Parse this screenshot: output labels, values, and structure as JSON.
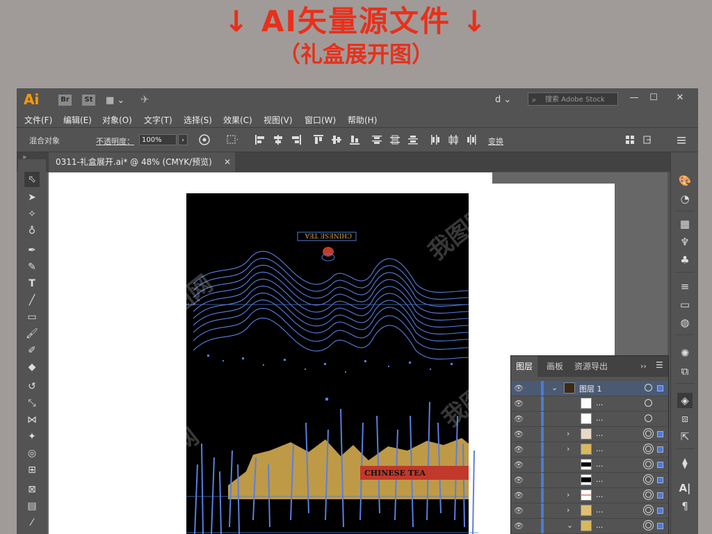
{
  "banner": {
    "title": "↓ AI矢量源文件 ↓",
    "subtitle": "（礼盒展开图）"
  },
  "appbar": {
    "logo": "Ai",
    "apps": [
      "Br",
      "St"
    ],
    "workspace_icon": "workspace-switcher-icon",
    "user": "d",
    "stock_search_placeholder": "搜索 Adobe Stock",
    "window_buttons": [
      "—",
      "☐",
      "✕"
    ]
  },
  "menubar": {
    "items": [
      "文件(F)",
      "编辑(E)",
      "对象(O)",
      "文字(T)",
      "选择(S)",
      "效果(C)",
      "视图(V)",
      "窗口(W)",
      "帮助(H)"
    ]
  },
  "control_bar": {
    "selection_type": "混合对象",
    "opacity_label": "不透明度：",
    "opacity_value": "100%",
    "transform_label": "变换"
  },
  "document_tab": {
    "title": "0311-礼盒展开.ai* @ 48% (CMYK/预览)",
    "close": "✕"
  },
  "artwork": {
    "bottom_label": "CHINESE TEA",
    "top_label": "CHINESE TEA",
    "colors": {
      "background": "#000000",
      "lines": "#5a7fe0",
      "gold": "#d9b85a",
      "red": "#c0392b"
    }
  },
  "layers_panel": {
    "tabs": [
      "图层",
      "画板",
      "资源导出"
    ],
    "layer_name": "图层 1",
    "sublayer_name": "...",
    "more": "››",
    "menu_icon": "panel-menu-icon"
  },
  "watermark": "我图网"
}
